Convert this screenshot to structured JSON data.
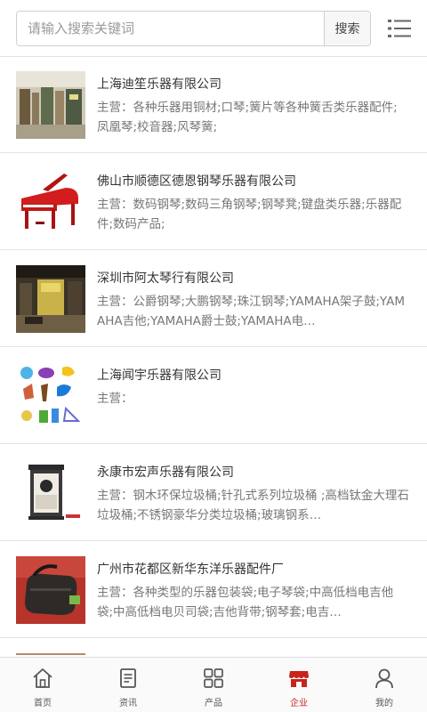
{
  "search": {
    "placeholder": "请输入搜索关键词",
    "button_label": "搜索"
  },
  "menu": {
    "icon": "menu-list-icon"
  },
  "companies": [
    {
      "name": "上海迪笙乐器有限公司",
      "business": "主营：各种乐器用铜材;口琴;簧片等各种簧舌类乐器配件;凤凰琴;校音器;风琴簧;",
      "image": "shop-interior-photo"
    },
    {
      "name": "佛山市顺德区德恩钢琴乐器有限公司",
      "business": "主营：数码钢琴;数码三角钢琴;钢琴凳;键盘类乐器;乐器配件;数码产品;",
      "image": "red-grand-piano-photo"
    },
    {
      "name": "深圳市阿太琴行有限公司",
      "business": "主营：公爵钢琴;大鹏钢琴;珠江钢琴;YAMAHA架子鼓;YAMAHA吉他;YAMAHA爵士鼓;YAMAHA电…",
      "image": "music-store-photo"
    },
    {
      "name": "上海闻宇乐器有限公司",
      "business": "主营：",
      "image": "instrument-icons-collage"
    },
    {
      "name": "永康市宏声乐器有限公司",
      "business": "主营：钢木环保垃圾桶;针孔式系列垃圾桶 ;高档钛金大理石垃圾桶;不锈钢豪华分类垃圾桶;玻璃钢系…",
      "image": "trash-bin-photo"
    },
    {
      "name": "广州市花都区新华东洋乐器配件厂",
      "business": "主营：各种类型的乐器包装袋;电子琴袋;中高低档电吉他袋;中高低档电贝司袋;吉他背带;钢琴套;电吉…",
      "image": "instrument-bag-photo"
    }
  ],
  "bottom_nav": [
    {
      "label": "首页",
      "icon": "home-icon",
      "active": false
    },
    {
      "label": "资讯",
      "icon": "news-icon",
      "active": false
    },
    {
      "label": "产品",
      "icon": "grid-icon",
      "active": false
    },
    {
      "label": "企业",
      "icon": "shop-icon",
      "active": true
    },
    {
      "label": "我的",
      "icon": "user-icon",
      "active": false
    }
  ],
  "colors": {
    "accent": "#c8231b",
    "icon_gray": "#555555",
    "text_gray": "#777777",
    "divider": "#e3e3e3"
  }
}
